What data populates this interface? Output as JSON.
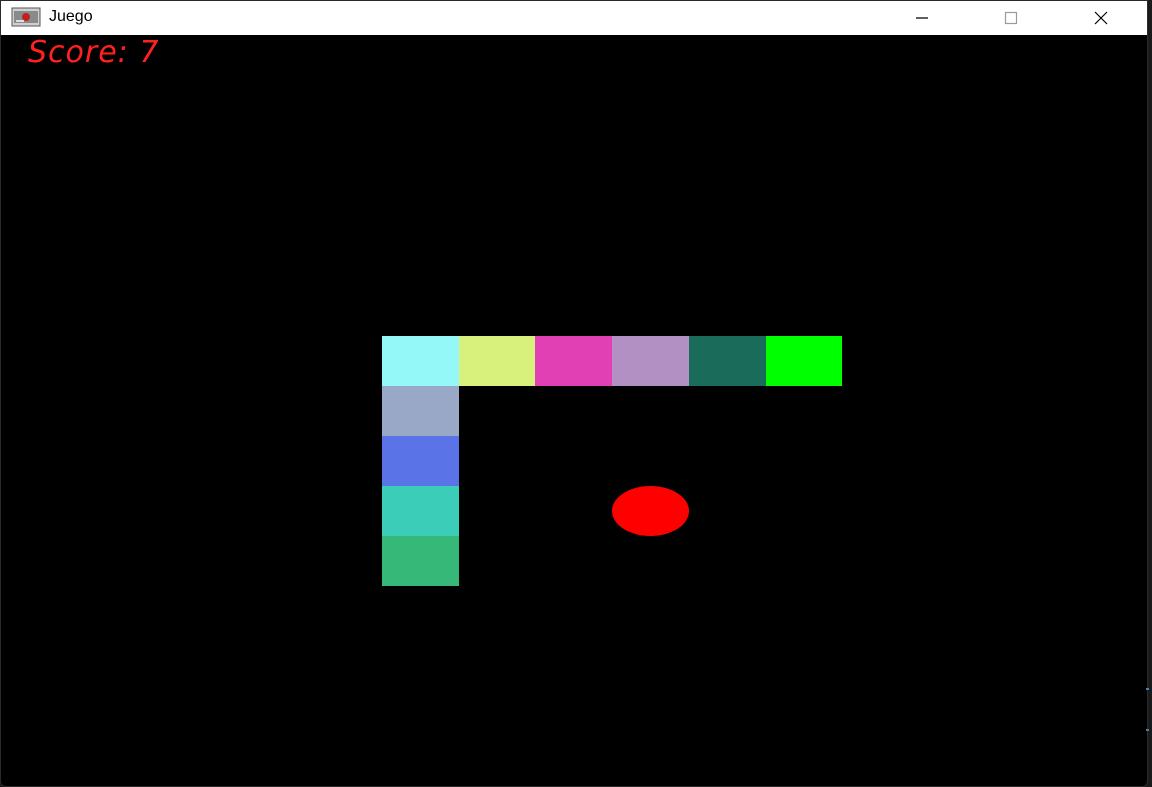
{
  "window": {
    "title": "Juego",
    "icon": "java-app-icon",
    "controls": {
      "minimize": "minimize-icon",
      "maximize": "maximize-icon",
      "close": "close-icon"
    }
  },
  "game": {
    "score_text": "Score: 7",
    "score_color": "#ff2020",
    "background": "#000000",
    "snake": {
      "length": 10,
      "segment_colors": [
        "#00ff00",
        "#1a6b5a",
        "#b390c4",
        "#e040b4",
        "#d8f07c",
        "#94f8f8",
        "#9aa8c8",
        "#5a74e8",
        "#3ccdb8",
        "#36b878"
      ]
    },
    "food": {
      "color": "#ff0000",
      "shape": "oval"
    }
  }
}
